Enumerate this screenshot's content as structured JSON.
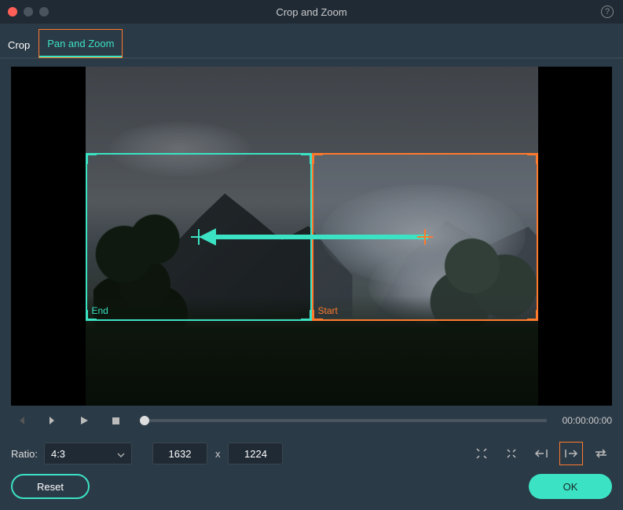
{
  "window": {
    "title": "Crop and Zoom"
  },
  "tabs": {
    "crop": "Crop",
    "pan_zoom": "Pan and Zoom"
  },
  "regions": {
    "start_label": "Start",
    "end_label": "End"
  },
  "transport": {
    "timecode": "00:00:00:00"
  },
  "ratio": {
    "label": "Ratio:",
    "selected": "4:3",
    "width": "1632",
    "separator": "x",
    "height": "1224"
  },
  "buttons": {
    "reset": "Reset",
    "ok": "OK"
  }
}
